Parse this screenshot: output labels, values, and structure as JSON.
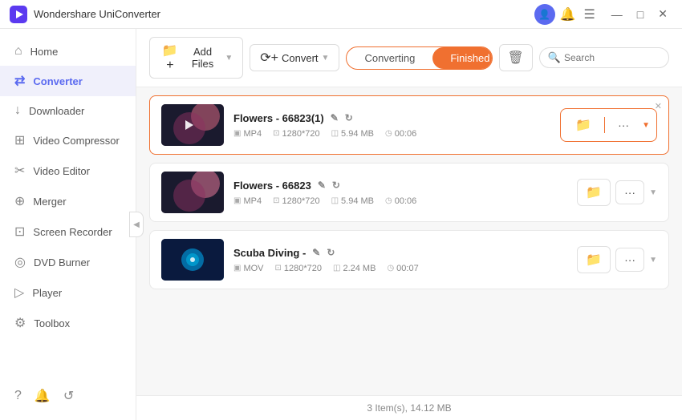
{
  "app": {
    "title": "Wondershare UniConverter",
    "logo_icon": "▶"
  },
  "titlebar": {
    "avatar_icon": "👤",
    "bell_icon": "🔔",
    "menu_icon": "☰",
    "minimize_icon": "—",
    "maximize_icon": "□",
    "close_icon": "✕"
  },
  "sidebar": {
    "items": [
      {
        "id": "home",
        "label": "Home",
        "icon": "⌂"
      },
      {
        "id": "converter",
        "label": "Converter",
        "icon": "⇄",
        "active": true
      },
      {
        "id": "downloader",
        "label": "Downloader",
        "icon": "↓"
      },
      {
        "id": "video-compressor",
        "label": "Video Compressor",
        "icon": "⊞"
      },
      {
        "id": "video-editor",
        "label": "Video Editor",
        "icon": "✂"
      },
      {
        "id": "merger",
        "label": "Merger",
        "icon": "⊕"
      },
      {
        "id": "screen-recorder",
        "label": "Screen Recorder",
        "icon": "⊡"
      },
      {
        "id": "dvd-burner",
        "label": "DVD Burner",
        "icon": "◎"
      },
      {
        "id": "player",
        "label": "Player",
        "icon": "▷"
      },
      {
        "id": "toolbox",
        "label": "Toolbox",
        "icon": "⚙"
      }
    ],
    "bottom_icons": [
      "?",
      "🔔",
      "↺"
    ]
  },
  "toolbar": {
    "add_file_label": "Add Files",
    "add_file_icon": "+",
    "convert_label": "Convert",
    "convert_icon": "⟳",
    "tab_converting": "Converting",
    "tab_finished": "Finished",
    "delete_icon": "🗑",
    "search_placeholder": "Search",
    "search_icon": "🔍"
  },
  "files": [
    {
      "id": 1,
      "name": "Flowers - 66823(1)",
      "format": "MP4",
      "resolution": "1280*720",
      "size": "5.94 MB",
      "duration": "00:06",
      "thumb_type": "flowers",
      "highlighted": true,
      "show_close": true
    },
    {
      "id": 2,
      "name": "Flowers - 66823",
      "format": "MP4",
      "resolution": "1280*720",
      "size": "5.94 MB",
      "duration": "00:06",
      "thumb_type": "flowers2",
      "highlighted": false,
      "show_close": false
    },
    {
      "id": 3,
      "name": "Scuba Diving -",
      "format": "MOV",
      "resolution": "1280*720",
      "size": "2.24 MB",
      "duration": "00:07",
      "thumb_type": "scuba",
      "highlighted": false,
      "show_close": false
    }
  ],
  "status": {
    "text": "3 Item(s), 14.12 MB"
  },
  "colors": {
    "accent": "#f07030",
    "active_sidebar": "#5b6af0"
  }
}
